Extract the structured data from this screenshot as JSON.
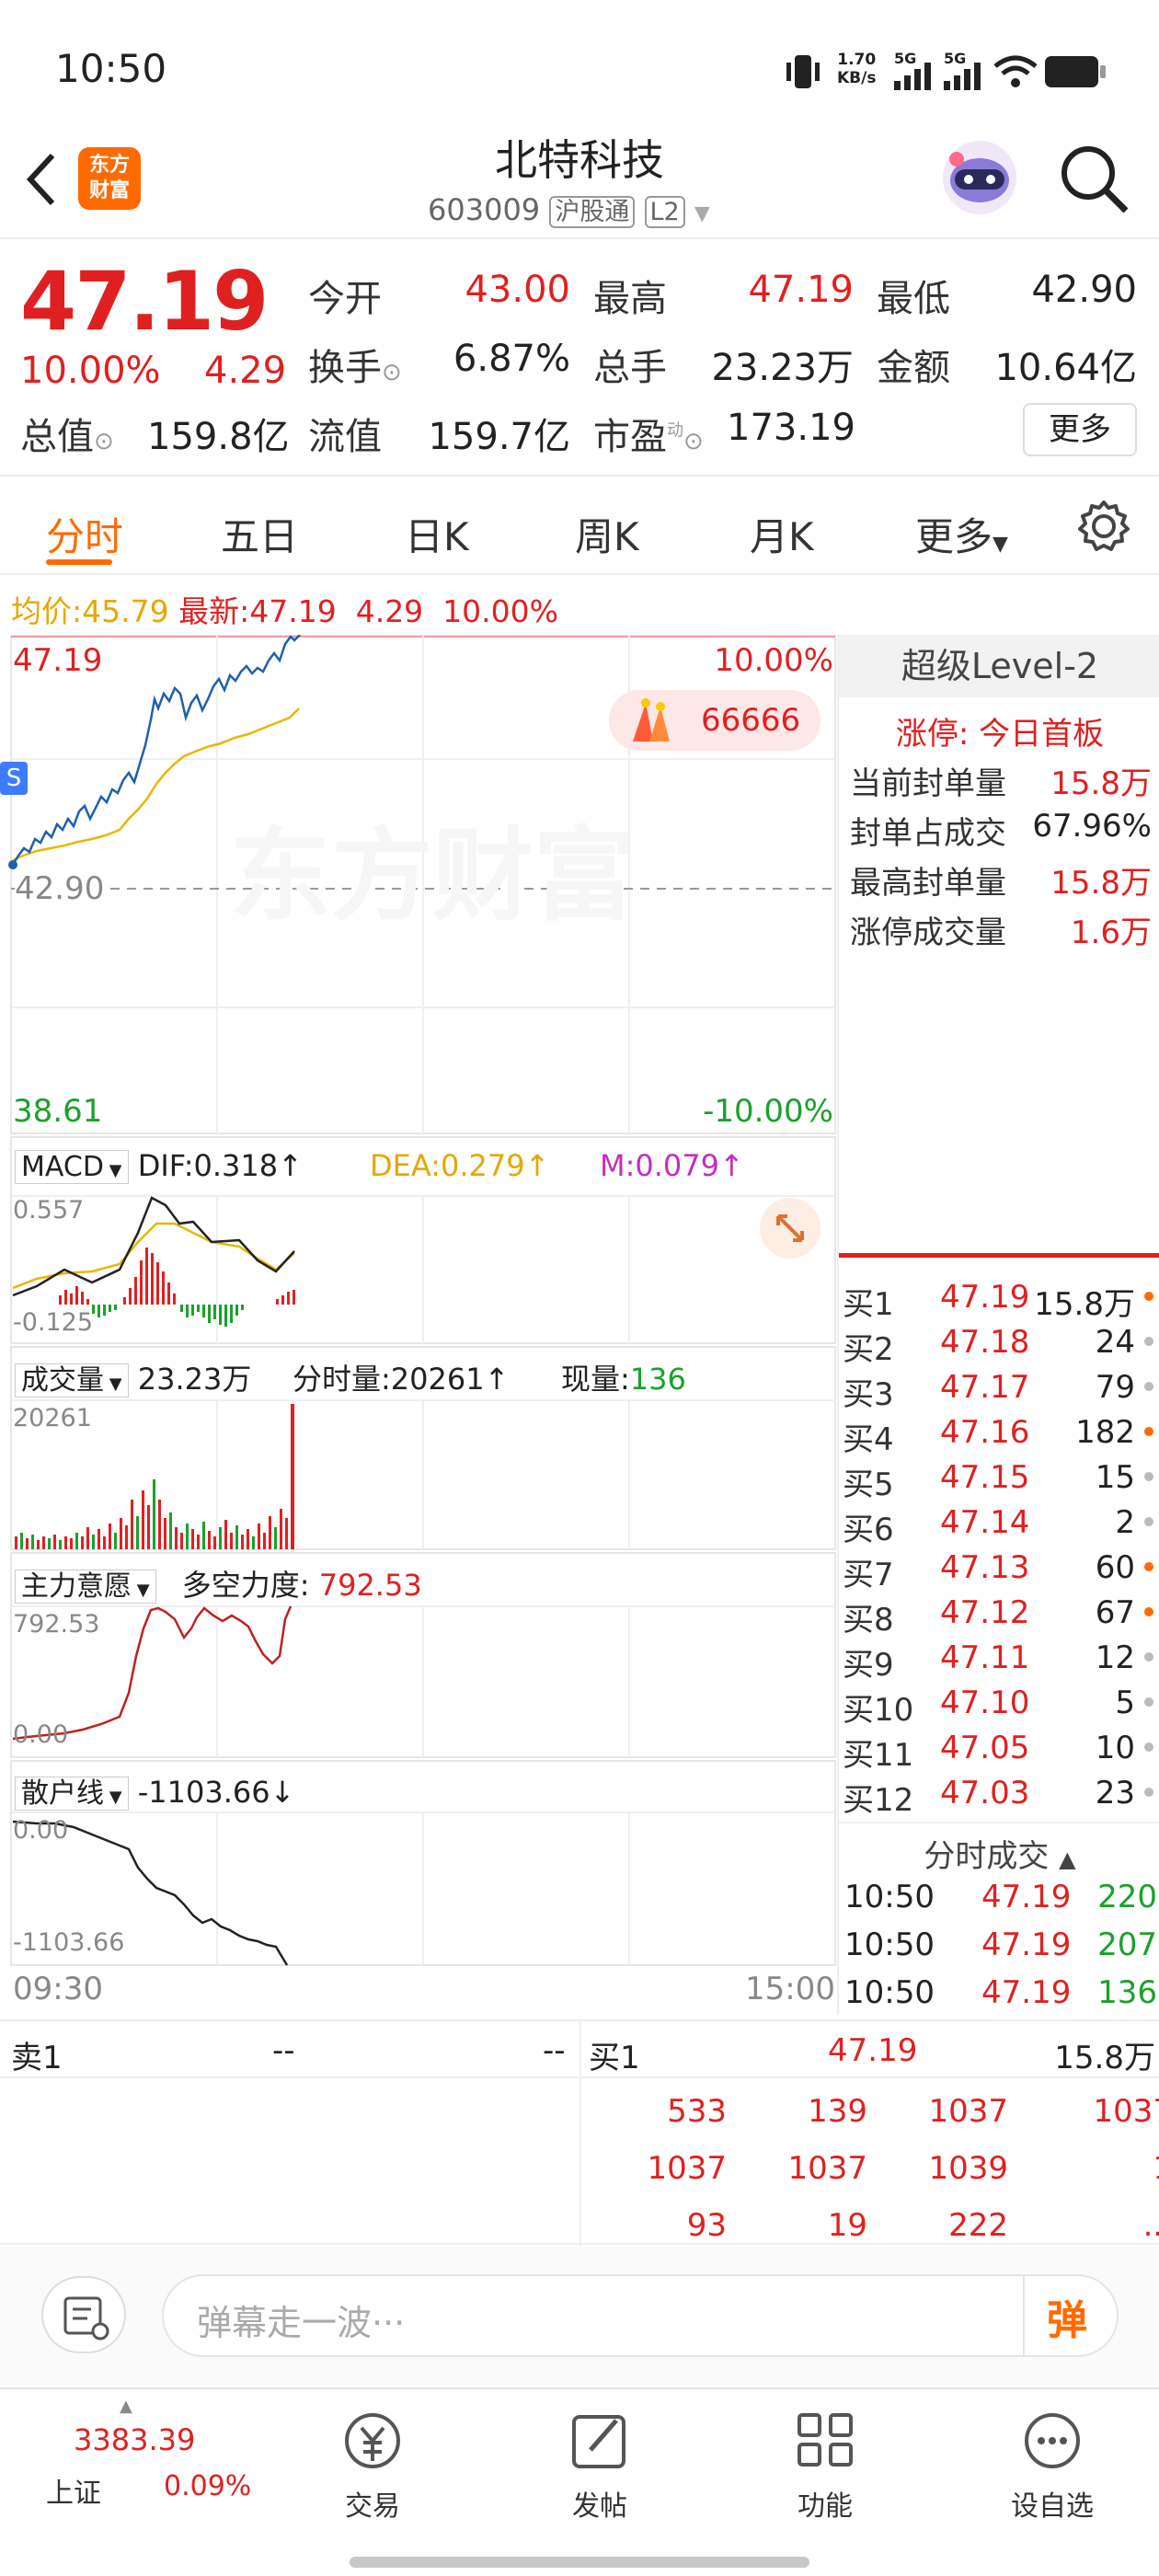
{
  "status_bar": {
    "time": "10:50",
    "net_speed_top": "1.70",
    "net_speed_bottom": "KB/s",
    "sig1": "5G",
    "sig2": "5G"
  },
  "header": {
    "title": "北特科技",
    "code": "603009",
    "tag_hgt": "沪股通",
    "tag_l2": "L2",
    "logo_line1": "东方",
    "logo_line2": "财富"
  },
  "quote": {
    "price": "47.19",
    "pct": "10.00%",
    "change": "4.29",
    "open_label": "今开",
    "open": "43.00",
    "high_label": "最高",
    "high": "47.19",
    "low_label": "最低",
    "low": "42.90",
    "turnover_label": "换手",
    "turnover": "6.87%",
    "volume_label": "总手",
    "volume": "23.23万",
    "amount_label": "金额",
    "amount": "10.64亿",
    "mcap_label": "总值",
    "mcap": "159.8亿",
    "float_label": "流值",
    "float": "159.7亿",
    "pe_label": "市盈",
    "pe_sup": "动",
    "pe": "173.19",
    "more_button": "更多"
  },
  "tabs": [
    "分时",
    "五日",
    "日K",
    "周K",
    "月K",
    "更多"
  ],
  "avg_line": {
    "avg_label": "均价:",
    "avg": "45.79",
    "latest_label": "最新:",
    "latest": "47.19",
    "change": "4.29",
    "pct": "10.00%"
  },
  "main_chart": {
    "max_price": "47.19",
    "max_pct": "10.00%",
    "min_price": "38.61",
    "min_pct": "-10.00%",
    "ref_price": "42.90",
    "badge": "66666",
    "s_marker": "S",
    "watermark": "东方财富",
    "time_start": "09:30",
    "time_end": "15:00"
  },
  "macd": {
    "label": "MACD",
    "dif": "DIF:0.318↑",
    "dea": "DEA:0.279↑",
    "m": "M:0.079↑",
    "top": "0.557",
    "bottom": "-0.125"
  },
  "volume_panel": {
    "label": "成交量",
    "total": "23.23万",
    "minute_label": "分时量:20261↑",
    "now_label": "现量:",
    "now": "136",
    "top": "20261"
  },
  "main_force": {
    "label": "主力意愿",
    "power_label": "多空力度:",
    "power": "792.53",
    "top": "792.53",
    "bottom": "0.00"
  },
  "retail": {
    "label": "散户线",
    "value": "-1103.66↓",
    "top": "0.00",
    "bottom": "-1103.66"
  },
  "level2": {
    "title": "超级Level-2",
    "limit_label": "涨停:",
    "limit_value": "今日首板",
    "rows": [
      {
        "label": "当前封单量",
        "value": "15.8万"
      },
      {
        "label": "封单占成交",
        "value": "67.96%"
      },
      {
        "label": "最高封单量",
        "value": "15.8万"
      },
      {
        "label": "涨停成交量",
        "value": "1.6万"
      }
    ]
  },
  "bids": [
    {
      "label": "买1",
      "price": "47.19",
      "qty": "15.8万",
      "dot": "orange"
    },
    {
      "label": "买2",
      "price": "47.18",
      "qty": "24",
      "dot": "gray"
    },
    {
      "label": "买3",
      "price": "47.17",
      "qty": "79",
      "dot": "gray"
    },
    {
      "label": "买4",
      "price": "47.16",
      "qty": "182",
      "dot": "orange"
    },
    {
      "label": "买5",
      "price": "47.15",
      "qty": "15",
      "dot": "gray"
    },
    {
      "label": "买6",
      "price": "47.14",
      "qty": "2",
      "dot": "gray"
    },
    {
      "label": "买7",
      "price": "47.13",
      "qty": "60",
      "dot": "orange"
    },
    {
      "label": "买8",
      "price": "47.12",
      "qty": "67",
      "dot": "orange"
    },
    {
      "label": "买9",
      "price": "47.11",
      "qty": "12",
      "dot": "gray"
    },
    {
      "label": "买10",
      "price": "47.10",
      "qty": "5",
      "dot": "gray"
    },
    {
      "label": "买11",
      "price": "47.05",
      "qty": "10",
      "dot": "gray"
    },
    {
      "label": "买12",
      "price": "47.03",
      "qty": "23",
      "dot": "gray"
    }
  ],
  "trades": {
    "title": "分时成交",
    "rows": [
      {
        "time": "10:50",
        "price": "47.19",
        "qty": "220"
      },
      {
        "time": "10:50",
        "price": "47.19",
        "qty": "207"
      },
      {
        "time": "10:50",
        "price": "47.19",
        "qty": "136"
      }
    ]
  },
  "bottom_table": {
    "sell1_label": "卖1",
    "sell1_price": "--",
    "sell1_qty": "--",
    "buy1_label": "买1",
    "buy1_price": "47.19",
    "buy1_qty": "15.8万",
    "queue": [
      [
        "533",
        "139",
        "1037",
        "1037"
      ],
      [
        "1037",
        "1037",
        "1039",
        "1"
      ],
      [
        "93",
        "19",
        "222",
        "..."
      ]
    ]
  },
  "danmu": {
    "placeholder": "弹幕走一波···",
    "button": "弹"
  },
  "bottom_nav": {
    "index_value": "3383.39",
    "index_name": "上证",
    "index_pct": "0.09%",
    "items": [
      "交易",
      "发帖",
      "功能",
      "设自选"
    ]
  },
  "colors": {
    "up": "#e02020",
    "down": "#1aa12c",
    "accent": "#ff6a00",
    "avg_line": "#e6a700",
    "price_line": "#1f5fb0"
  }
}
